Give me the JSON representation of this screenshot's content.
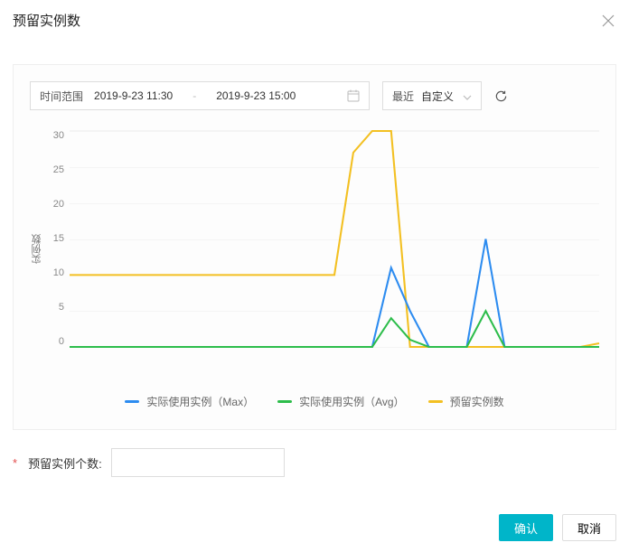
{
  "header": {
    "title": "预留实例数"
  },
  "dateRange": {
    "label": "时间范围",
    "start": "2019-9-23 11:30",
    "end": "2019-9-23 15:00",
    "separator": "-"
  },
  "recent": {
    "label": "最近",
    "value": "自定义"
  },
  "chart": {
    "yAxisLabel": "实例数",
    "yTicks": [
      "30",
      "25",
      "20",
      "15",
      "10",
      "5",
      "0"
    ]
  },
  "chart_data": {
    "type": "line",
    "title": "预留实例数",
    "ylabel": "实例数",
    "ylim": [
      0,
      30
    ],
    "series": [
      {
        "name": "实际使用实例（Max）",
        "color": "#2d8cf0",
        "values": [
          0,
          0,
          0,
          0,
          0,
          0,
          0,
          0,
          0,
          0,
          0,
          0,
          0,
          0,
          0,
          0,
          0,
          11,
          5,
          0,
          0,
          0,
          15,
          0,
          0,
          0,
          0,
          0,
          0
        ]
      },
      {
        "name": "实际使用实例（Avg）",
        "color": "#2dbd4b",
        "values": [
          0,
          0,
          0,
          0,
          0,
          0,
          0,
          0,
          0,
          0,
          0,
          0,
          0,
          0,
          0,
          0,
          0,
          4,
          1,
          0,
          0,
          0,
          5,
          0,
          0,
          0,
          0,
          0,
          0
        ]
      },
      {
        "name": "预留实例数",
        "color": "#f3c022",
        "values": [
          10,
          10,
          10,
          10,
          10,
          10,
          10,
          10,
          10,
          10,
          10,
          10,
          10,
          10,
          10,
          27,
          30,
          30,
          0,
          0,
          0,
          0,
          0,
          0,
          0,
          0,
          0,
          0,
          0.5
        ]
      }
    ]
  },
  "legend": {
    "max": "实际使用实例（Max）",
    "avg": "实际使用实例（Avg）",
    "reserved": "预留实例数"
  },
  "form": {
    "label": "预留实例个数:",
    "value": ""
  },
  "buttons": {
    "confirm": "确认",
    "cancel": "取消"
  }
}
